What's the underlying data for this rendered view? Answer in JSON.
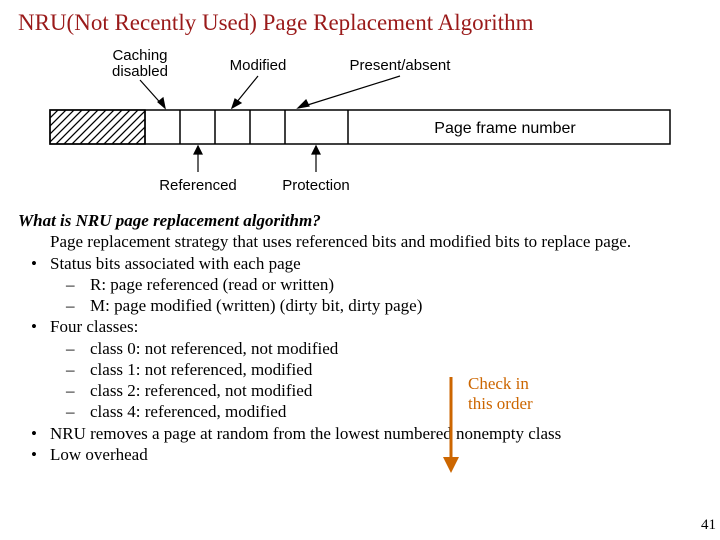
{
  "title": "NRU(Not Recently Used) Page Replacement Algorithm",
  "diagram": {
    "top_labels": {
      "l1": "Caching",
      "l1b": "disabled",
      "l2": "Modified",
      "l3": "Present/absent"
    },
    "right_label": "Page frame number",
    "bottom_labels": {
      "l1": "Referenced",
      "l2": "Protection"
    }
  },
  "body": {
    "question": "What is NRU page replacement algorithm?",
    "desc": "Page replacement strategy that uses referenced bits and modified bits to replace page.",
    "b1": "Status bits associated with each page",
    "b1s1": "R: page referenced (read or written)",
    "b1s2": "M: page modified (written)  (dirty bit, dirty page)",
    "b2": "Four classes:",
    "b2s1": "class 0: not referenced, not modified",
    "b2s2": "class 1: not referenced, modified",
    "b2s3": "class 2: referenced, not modified",
    "b2s4": "class 4: referenced, modified",
    "b3": "NRU removes a page at random from the lowest numbered nonempty class",
    "b4": "Low overhead"
  },
  "annotation": {
    "line1": "Check in",
    "line2": "this order"
  },
  "page_number": "41"
}
